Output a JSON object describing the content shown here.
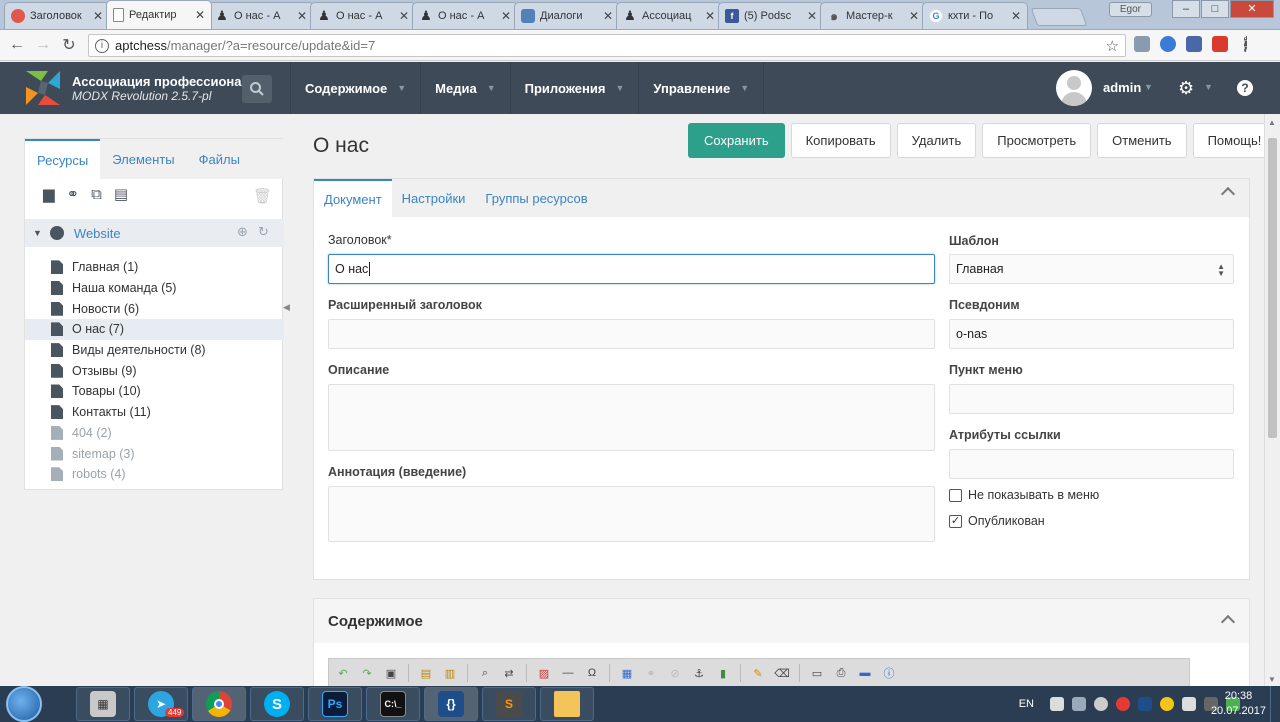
{
  "browser": {
    "tabs": [
      {
        "title": "Заголовок",
        "icon": "dot-icon",
        "color": "#e0584b"
      },
      {
        "title": "Редактир",
        "icon": "page-icon",
        "color": "#888888"
      },
      {
        "title": "О нас - А",
        "icon": "chess-icon",
        "color": "#333333"
      },
      {
        "title": "О нас - А",
        "icon": "chess-icon",
        "color": "#333333"
      },
      {
        "title": "О нас - А",
        "icon": "chess-icon",
        "color": "#333333"
      },
      {
        "title": "Диалоги",
        "icon": "vk-icon",
        "color": "#5181b8"
      },
      {
        "title": "Ассоциац",
        "icon": "chess-icon",
        "color": "#333333"
      },
      {
        "title": "(5) Podsc",
        "icon": "facebook-icon",
        "color": "#3b5998"
      },
      {
        "title": "Мастер-к",
        "icon": "spiral-icon",
        "color": "#555555"
      },
      {
        "title": "кхти - По",
        "icon": "google-icon",
        "color": "#4285f4"
      }
    ],
    "user": "Egor",
    "window_controls": [
      "–",
      "□",
      "✕"
    ],
    "url_host": "aptchess",
    "url_path": "/manager/?a=resource/update&id=7"
  },
  "topbar": {
    "site_name": "Ассоциация профессиона...",
    "version": "MODX Revolution 2.5.7-pl",
    "menu": [
      "Содержимое",
      "Медиа",
      "Приложения",
      "Управление"
    ],
    "username": "admin"
  },
  "left_panel": {
    "tabs": [
      "Ресурсы",
      "Элементы",
      "Файлы"
    ],
    "root": "Website",
    "tree": [
      {
        "label": "Главная (1)",
        "state": "normal"
      },
      {
        "label": "Наша команда (5)",
        "state": "normal"
      },
      {
        "label": "Новости (6)",
        "state": "normal"
      },
      {
        "label": "О нас (7)",
        "state": "selected"
      },
      {
        "label": "Виды деятельности (8)",
        "state": "normal"
      },
      {
        "label": "Отзывы (9)",
        "state": "normal"
      },
      {
        "label": "Товары (10)",
        "state": "normal"
      },
      {
        "label": "Контакты (11)",
        "state": "normal"
      },
      {
        "label": "404 (2)",
        "state": "unpublished"
      },
      {
        "label": "sitemap (3)",
        "state": "unpublished"
      },
      {
        "label": "robots (4)",
        "state": "unpublished"
      }
    ]
  },
  "page": {
    "title": "О нас",
    "actions": {
      "save": "Сохранить",
      "copy": "Копировать",
      "delete": "Удалить",
      "view": "Просмотреть",
      "cancel": "Отменить",
      "help": "Помощь!"
    },
    "tabs": [
      "Документ",
      "Настройки",
      "Группы ресурсов"
    ]
  },
  "form": {
    "pagetitle_label": "Заголовок*",
    "pagetitle_value": "О нас",
    "longtitle_label": "Расширенный заголовок",
    "longtitle_value": "",
    "description_label": "Описание",
    "description_value": "",
    "introtext_label": "Аннотация (введение)",
    "introtext_value": "",
    "template_label": "Шаблон",
    "template_value": "Главная",
    "alias_label": "Псевдоним",
    "alias_value": "o-nas",
    "menutitle_label": "Пункт меню",
    "menutitle_value": "",
    "linkattr_label": "Атрибуты ссылки",
    "linkattr_value": "",
    "hidemenu_label": "Не показывать в меню",
    "hidemenu_checked": false,
    "published_label": "Опубликован",
    "published_checked": true
  },
  "content_section": {
    "title": "Содержимое"
  },
  "taskbar": {
    "lang": "EN",
    "time": "20:38",
    "date": "20.07.2017",
    "telegram_badge": "449"
  },
  "colors": {
    "topbar": "#3e4a57",
    "accent": "#2ca08a",
    "link": "#3b84c4"
  }
}
